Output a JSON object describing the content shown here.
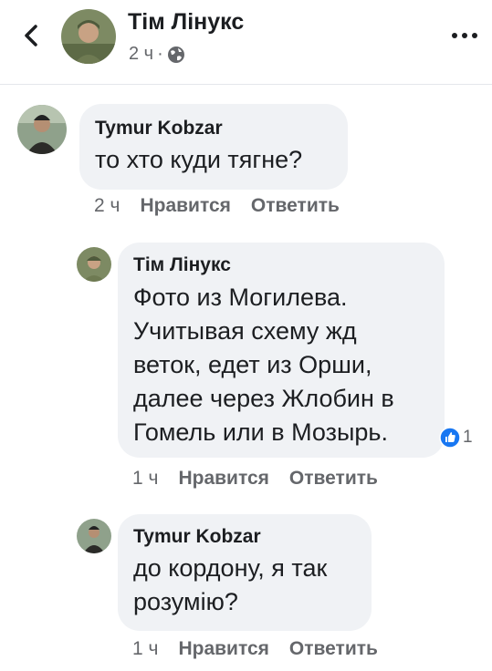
{
  "header": {
    "author": "Тім Лінукс",
    "time": "2 ч",
    "separator": "·"
  },
  "comments": [
    {
      "author": "Tymur Kobzar",
      "lines": [
        "то хто куди тягне?"
      ],
      "time": "2 ч",
      "like_label": "Нравится",
      "reply_label": "Ответить"
    },
    {
      "author": "Тім Лінукс",
      "lines": [
        "Фото из Могилева.",
        "Учитывая схему жд",
        "веток, едет из Орши,",
        "далее через Жлобин в",
        "Гомель или в Мозырь."
      ],
      "time": "1 ч",
      "like_label": "Нравится",
      "reply_label": "Ответить",
      "reaction_count": "1"
    },
    {
      "author": "Tymur Kobzar",
      "lines": [
        "до кордону, я так",
        "розумію?"
      ],
      "time": "1 ч",
      "like_label": "Нравится",
      "reply_label": "Ответить"
    }
  ],
  "icons": {
    "back": "chevron-left-icon",
    "privacy": "globe-icon",
    "more": "more-dots-icon",
    "reaction": "like-thumb-icon"
  },
  "colors": {
    "bubble": "#f0f2f5",
    "secondary_text": "#65676b",
    "like_blue": "#1877f2"
  }
}
